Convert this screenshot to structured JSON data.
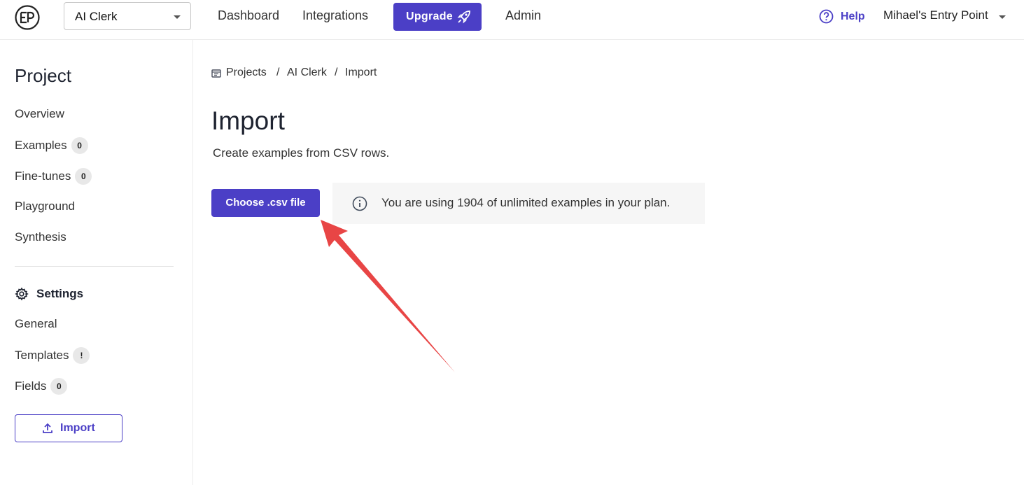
{
  "header": {
    "project_select": "AI Clerk",
    "nav": [
      "Dashboard",
      "Integrations"
    ],
    "upgrade_label": "Upgrade",
    "admin_label": "Admin",
    "help_label": "Help",
    "user_menu": "Mihael's Entry Point"
  },
  "sidebar": {
    "title": "Project",
    "items": [
      {
        "label": "Overview"
      },
      {
        "label": "Examples",
        "badge": "0"
      },
      {
        "label": "Fine-tunes",
        "badge": "0"
      },
      {
        "label": "Playground"
      },
      {
        "label": "Synthesis"
      }
    ],
    "settings_title": "Settings",
    "settings_items": [
      {
        "label": "General"
      },
      {
        "label": "Templates",
        "badge": "!"
      },
      {
        "label": "Fields",
        "badge": "0"
      }
    ],
    "import_label": "Import"
  },
  "breadcrumb": [
    "Projects",
    "AI Clerk",
    "Import"
  ],
  "main": {
    "title": "Import",
    "subtitle": "Create examples from CSV rows.",
    "choose_label": "Choose .csv file",
    "info_text": "You are using 1904 of unlimited examples in your plan."
  },
  "colors": {
    "accent": "#4b3fc6",
    "annotation_arrow": "#e84545"
  }
}
